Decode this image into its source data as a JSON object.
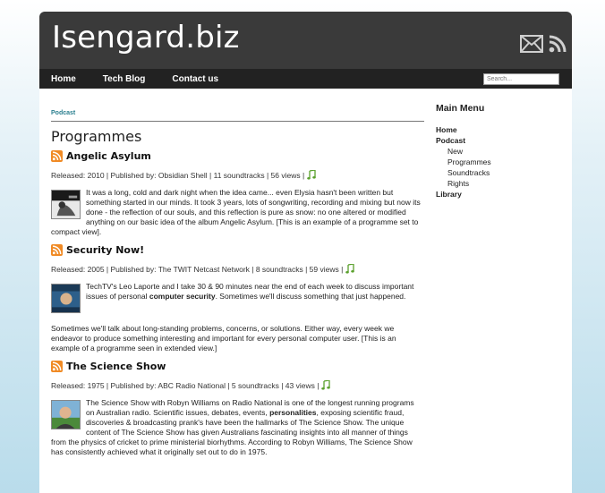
{
  "site": {
    "title": "Isengard.biz"
  },
  "icons": {
    "mail": "mail-icon",
    "feed": "rss-feed-icon",
    "programme": "rss-icon",
    "audio": "music-note-icon"
  },
  "nav": {
    "items": [
      {
        "label": "Home"
      },
      {
        "label": "Tech Blog"
      },
      {
        "label": "Contact us"
      }
    ],
    "search_placeholder": "Search..."
  },
  "breadcrumb": "Podcast",
  "page_title": "Programmes",
  "programmes": [
    {
      "title": "Angelic Asylum",
      "meta": "Released: 2010 | Published by: Obsidian Shell | 11 soundtracks | 56 views |",
      "body": "It was a long, cold and dark night when the idea came... even Elysia hasn't been written but something started in our minds. It took 3 years, lots of songwriting, recording and mixing but now its done - the reflection of our souls, and this reflection is pure as snow: no one altered or modified anything on our basic idea of the album Angelic Asylum. [This is an example of a programme set to compact view]."
    },
    {
      "title": "Security Now!",
      "meta": "Released: 2005 | Published by: The TWIT Netcast Network | 8 soundtracks | 59 views |",
      "body_pre": "TechTV's Leo Laporte and I take 30 & 90 minutes near the end of each week to discuss important issues of personal ",
      "body_bold": "computer security",
      "body_post": ". Sometimes we'll discuss something that just happened.",
      "extra": "Sometimes we'll talk about long-standing problems, concerns, or solutions. Either way, every week we endeavor to produce something interesting and important for every personal computer user. [This is an example of a programme seen in extended view.]"
    },
    {
      "title": "The Science Show",
      "meta": "Released: 1975 | Published by: ABC Radio National | 5 soundtracks | 43 views |",
      "body_pre": "The Science Show with Robyn Williams on Radio National is one of the longest running programs on Australian radio. Scientific issues, debates, events, ",
      "body_bold": "personalities",
      "body_post": ", exposing scientific fraud, discoveries & broadcasting prank's have been the hallmarks of The Science Show. The unique content of The Science Show has given Australians fascinating insights into all manner of things from the physics of cricket to prime ministerial biorhythms. According to Robyn Williams, The Science Show has consistently achieved what it originally set out to do in 1975."
    }
  ],
  "sidebar": {
    "title": "Main Menu",
    "items": [
      {
        "label": "Home"
      },
      {
        "label": "Podcast"
      },
      {
        "label": "New"
      },
      {
        "label": "Programmes"
      },
      {
        "label": "Soundtracks"
      },
      {
        "label": "Rights"
      },
      {
        "label": "Library"
      }
    ]
  }
}
